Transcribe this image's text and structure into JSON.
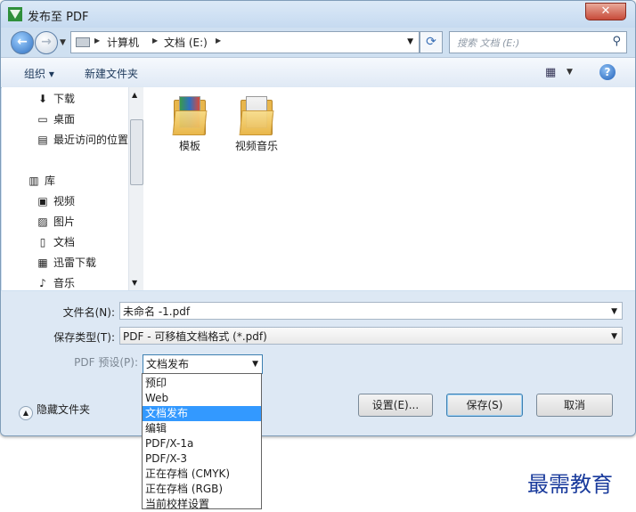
{
  "window": {
    "title": "发布至 PDF",
    "close": "✕"
  },
  "nav": {
    "path": [
      "计算机",
      "文档 (E:)"
    ],
    "search_placeholder": "搜索 文档 (E:)"
  },
  "toolbar": {
    "organize": "组织 ▾",
    "new_folder": "新建文件夹",
    "help": "?"
  },
  "sidebar": {
    "items": [
      {
        "label": "下载",
        "icon": "download-folder-icon"
      },
      {
        "label": "桌面",
        "icon": "desktop-icon"
      },
      {
        "label": "最近访问的位置",
        "icon": "recent-places-icon"
      },
      {
        "label": "库",
        "icon": "library-icon"
      },
      {
        "label": "视频",
        "icon": "videos-icon"
      },
      {
        "label": "图片",
        "icon": "pictures-icon"
      },
      {
        "label": "文档",
        "icon": "documents-icon"
      },
      {
        "label": "迅雷下载",
        "icon": "thunder-download-icon"
      },
      {
        "label": "音乐",
        "icon": "music-icon"
      }
    ]
  },
  "files": [
    {
      "name": "模板",
      "icon": "folder-icon"
    },
    {
      "name": "视频音乐",
      "icon": "folder-icon"
    }
  ],
  "form": {
    "filename_label": "文件名(N):",
    "filename_value": "未命名 -1.pdf",
    "filetype_label": "保存类型(T):",
    "filetype_value": "PDF - 可移植文档格式 (*.pdf)",
    "preset_label": "PDF 预设(P):",
    "preset_value": "文档发布"
  },
  "preset_options": [
    "预印",
    "Web",
    "文档发布",
    "编辑",
    "PDF/X-1a",
    "PDF/X-3",
    "正在存档 (CMYK)",
    "正在存档 (RGB)",
    "当前校样设置"
  ],
  "selected_preset_index": 2,
  "buttons": {
    "hide_folders": "隐藏文件夹",
    "settings": "设置(E)...",
    "save": "保存(S)",
    "cancel": "取消"
  },
  "watermark": "最需教育"
}
